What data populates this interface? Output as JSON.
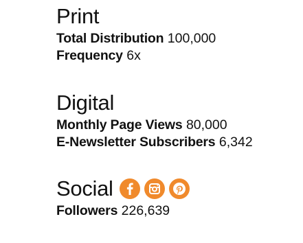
{
  "print": {
    "heading": "Print",
    "stats": [
      {
        "label": "Total Distribution",
        "value": "100,000"
      },
      {
        "label": "Frequency",
        "value": "6x"
      }
    ]
  },
  "digital": {
    "heading": "Digital",
    "stats": [
      {
        "label": "Monthly Page Views",
        "value": "80,000"
      },
      {
        "label": "E-Newsletter Subscribers",
        "value": "6,342"
      }
    ]
  },
  "social": {
    "heading": "Social",
    "icons": [
      "facebook-icon",
      "instagram-icon",
      "pinterest-icon"
    ],
    "icon_color": "#f08a2c",
    "stats": [
      {
        "label": "Followers",
        "value": "226,639"
      }
    ]
  }
}
